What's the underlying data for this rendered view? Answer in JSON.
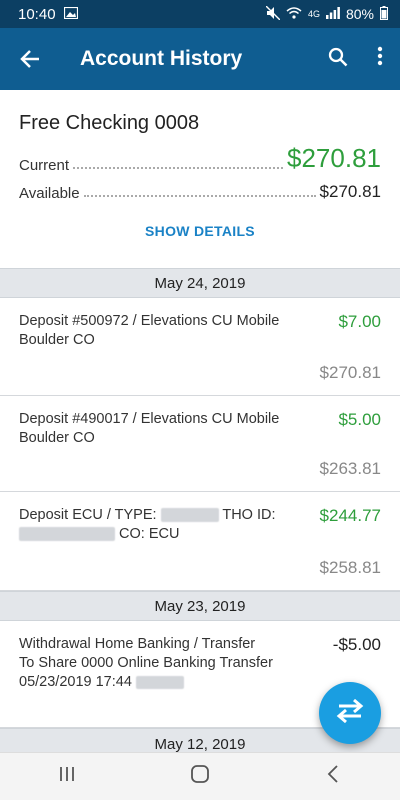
{
  "status_bar": {
    "time": "10:40",
    "network": "4G",
    "battery": "80%"
  },
  "app_bar": {
    "title": "Account History"
  },
  "account": {
    "name": "Free Checking 0008",
    "current_label": "Current",
    "current_value": "$270.81",
    "available_label": "Available",
    "available_value": "$270.81",
    "show_details": "SHOW DETAILS"
  },
  "groups": [
    {
      "date": "May 24, 2019",
      "transactions": [
        {
          "line1": "Deposit #500972 / Elevations CU Mobile",
          "line2": "Boulder CO",
          "amount": "$7.00",
          "balance": "$270.81"
        },
        {
          "line1": "Deposit #490017 / Elevations CU Mobile",
          "line2": "Boulder CO",
          "amount": "$5.00",
          "balance": "$263.81"
        },
        {
          "line1_a": "Deposit ECU / TYPE:",
          "line1_b": "THO ID:",
          "line2_b": "CO: ECU",
          "amount": "$244.77",
          "balance": "$258.81"
        }
      ]
    },
    {
      "date": "May 23, 2019",
      "transactions": [
        {
          "line1": "Withdrawal Home Banking / Transfer",
          "line2": "To Share 0000 Online Banking Transfer",
          "line3": "05/23/2019 17:44",
          "amount": "-$5.00"
        }
      ]
    },
    {
      "date": "May 12, 2019"
    }
  ],
  "colors": {
    "app_bar": "#0f5d91",
    "status_bar": "#0c3f63",
    "positive": "#2e9e3c",
    "link": "#1a82c6",
    "fab": "#1a9ee1"
  },
  "icons": {
    "back": "arrow-left-icon",
    "search": "search-icon",
    "more": "more-vert-icon",
    "fab": "transfer-icon",
    "nav_recent": "recent-apps-icon",
    "nav_home": "home-icon",
    "nav_back": "back-icon"
  }
}
